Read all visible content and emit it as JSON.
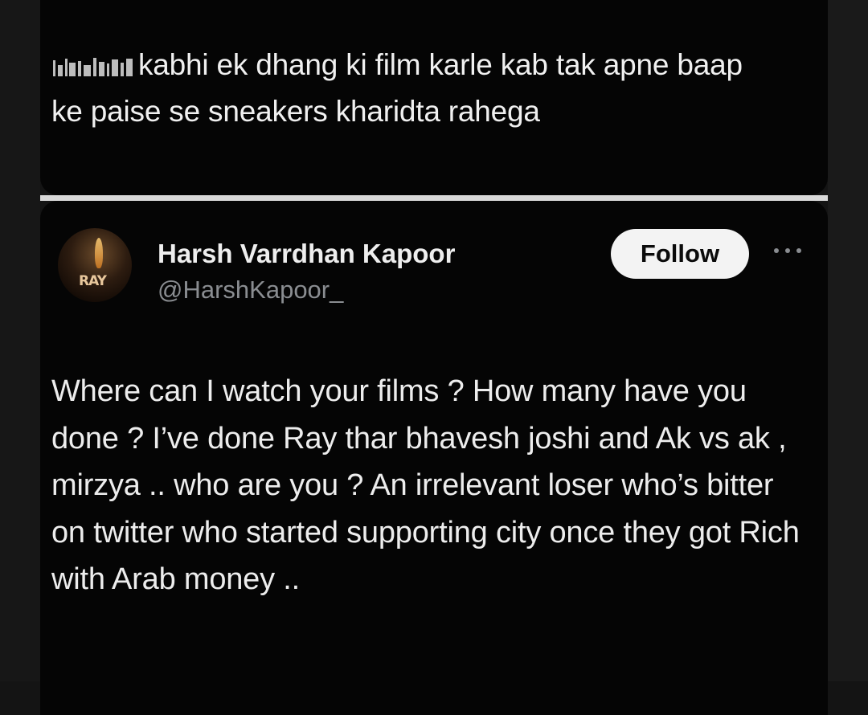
{
  "previous_tweet": {
    "text": "kabhi ek dhang ki film karle kab tak apne baap ke paise se sneakers kharidta rahega"
  },
  "reply_tweet": {
    "author": {
      "name": "Harsh Varrdhan Kapoor",
      "handle": "@HarshKapoor_",
      "avatar_text": "RAY"
    },
    "follow_label": "Follow",
    "more_icon": "more-horizontal-icon",
    "text": "Where can I watch your films ? How many have you done ? I’ve done Ray thar bhavesh joshi and Ak vs ak , mirzya .. who are you ? An irrelevant loser who’s bitter on twitter who started supporting city once they got Rich with Arab money .."
  },
  "colors": {
    "background": "#050505",
    "divider": "#d9d9d9",
    "text": "#ededed",
    "handle": "#8a8d91",
    "follow_button_bg": "#f3f3f3"
  }
}
